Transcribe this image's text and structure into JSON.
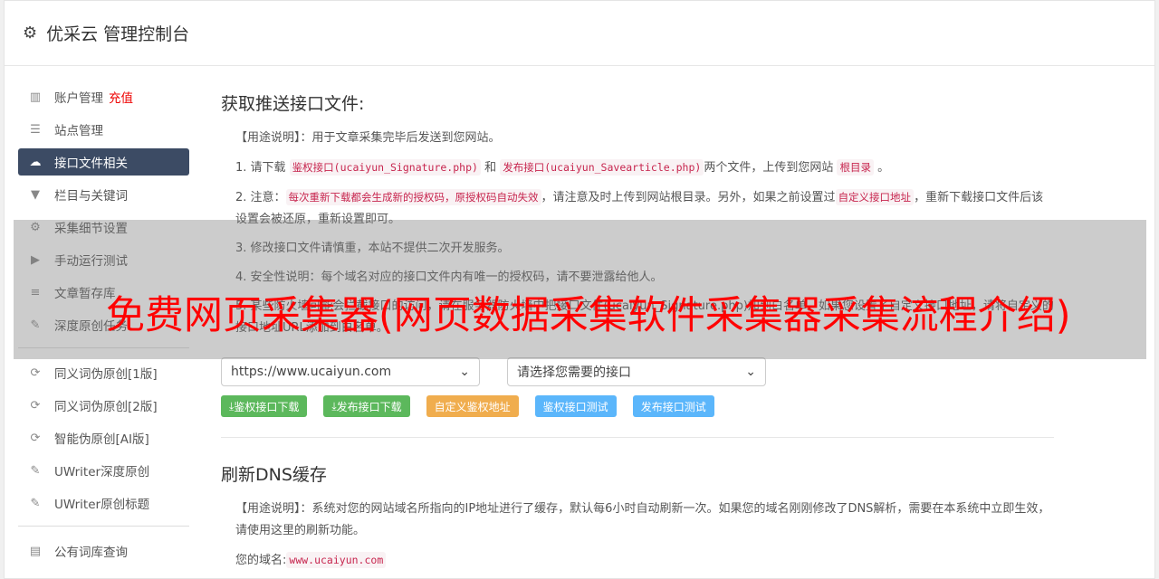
{
  "header": {
    "title": "优采云 管理控制台",
    "icon": "gear-icon"
  },
  "sidebar": {
    "items": [
      {
        "label": "账户管理",
        "badge": "充值",
        "icon": "bar-chart-icon"
      },
      {
        "label": "站点管理",
        "icon": "server-icon"
      },
      {
        "label": "接口文件相关",
        "icon": "cloud-upload-icon",
        "active": true
      },
      {
        "label": "栏目与关键词",
        "icon": "filter-icon"
      },
      {
        "label": "采集细节设置",
        "icon": "gears-icon"
      },
      {
        "label": "手动运行测试",
        "icon": "play-circle-icon"
      },
      {
        "label": "文章暂存库",
        "icon": "database-icon"
      },
      {
        "label": "深度原创任务",
        "icon": "edit-icon"
      },
      {
        "label": "同义词伪原创[1版]",
        "icon": "refresh-icon"
      },
      {
        "label": "同义词伪原创[2版]",
        "icon": "refresh-icon"
      },
      {
        "label": "智能伪原创[AI版]",
        "icon": "refresh-icon"
      },
      {
        "label": "UWriter深度原创",
        "icon": "edit-icon"
      },
      {
        "label": "UWriter原创标题",
        "icon": "edit-icon"
      },
      {
        "label": "公有词库查询",
        "icon": "book-icon"
      }
    ]
  },
  "section1": {
    "title": "获取推送接口文件:",
    "usage": "【用途说明】：用于文章采集完毕后发送到您网站。",
    "l1a": "1. 请下载",
    "l1b": "鉴权接口(ucaiyun_Signature.php)",
    "l1c": "和",
    "l1d": "发布接口(ucaiyun_Savearticle.php)",
    "l1e": "两个文件，上传到您网站",
    "l1f": "根目录",
    "l1g": "。",
    "l2a": "2. 注意：",
    "l2b": "每次重新下载都会生成新的授权码，原授权码自动失效",
    "l2c": "，请注意及时上传到网站根目录。另外，如果之前设置过",
    "l2d": "自定义接口地址",
    "l2e": "，重新下载接口文件后该设置会被还原，重新设置即可。",
    "l3": "3. 修改接口文件请慎重，本站不提供二次开发服务。",
    "l4": "4. 安全性说明：每个域名对应的接口文件内有唯一的授权码，请不要泄露给他人。",
    "l5": "5. 某些防火墙可能会拦截接口的访问，请在服务器防火墙中把接口文件(ucaiyun_Signature.php)加到白名单，如果您设置了自定义接口地址，请将自定义的接口地址URL添加到白名单。",
    "site_select": "https://www.ucaiyun.com",
    "api_select": "请选择您需要的接口",
    "buttons": [
      "鉴权接口下载",
      "发布接口下载",
      "自定义鉴权地址",
      "鉴权接口测试",
      "发布接口测试"
    ]
  },
  "section2": {
    "title": "刷新DNS缓存",
    "usage": "【用途说明】：系统对您的网站域名所指向的IP地址进行了缓存，默认每6小时自动刷新一次。如果您的域名刚刚修改了DNS解析，需要在本系统中立即生效，请使用这里的刷新功能。",
    "domain_label": "您的域名:",
    "domain": "www.ucaiyun.com"
  },
  "overlay": {
    "text": "免费网页采集器(网页数据采集软件采集器采集流程介绍)"
  }
}
